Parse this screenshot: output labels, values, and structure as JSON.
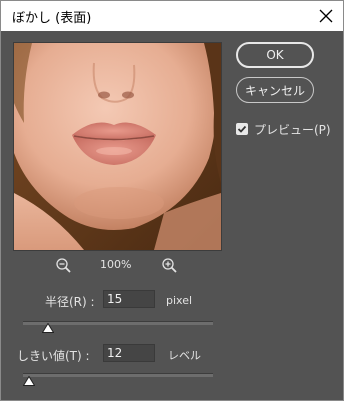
{
  "dialog": {
    "title": "ぼかし (表面)",
    "ok_label": "OK",
    "cancel_label": "キャンセル",
    "preview_label": "プレビュー(P)",
    "preview_checked": true,
    "zoom_level": "100%"
  },
  "params": {
    "radius": {
      "label": "半径(R) :",
      "value": "15",
      "unit": "pixel",
      "slider_fraction": 0.13
    },
    "threshold": {
      "label": "しきい値(T) :",
      "value": "12",
      "unit": "レベル",
      "slider_fraction": 0.03
    }
  },
  "colors": {
    "panel_bg": "#535353",
    "titlebar_bg": "#ffffff",
    "text": "#e3e3e3"
  },
  "icons": {
    "close": "close-icon",
    "zoom_out": "zoom-out-icon",
    "zoom_in": "zoom-in-icon",
    "check": "check-icon"
  }
}
